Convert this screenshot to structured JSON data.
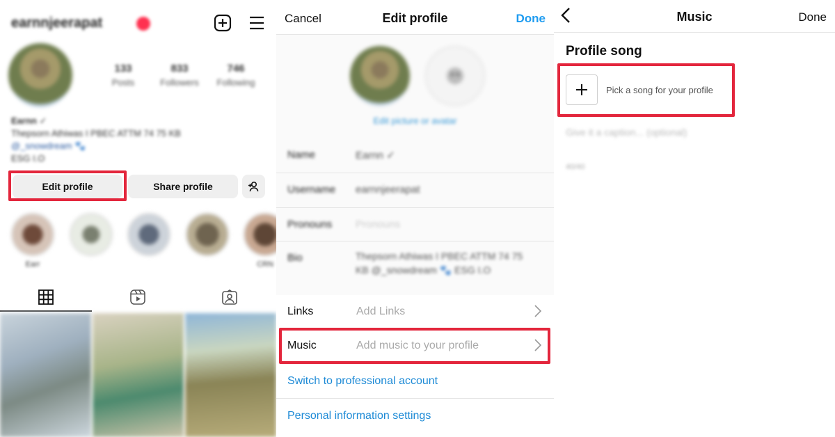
{
  "profile": {
    "username": "earnnjeerapat",
    "stats": [
      {
        "number": "133",
        "label": "Posts"
      },
      {
        "number": "833",
        "label": "Followers"
      },
      {
        "number": "746",
        "label": "Following"
      }
    ],
    "bio_name": "Earnn ✓",
    "bio_line1": "Thepsorn Athiwas I PBEC ATTM 74 75 KB",
    "bio_line2": "@_snowdream 🐾",
    "bio_line3": "ESG I.O",
    "edit_button": "Edit profile",
    "share_button": "Share profile",
    "highlights": [
      "Earr",
      "",
      "",
      "",
      "CRN"
    ]
  },
  "edit": {
    "cancel": "Cancel",
    "title": "Edit profile",
    "done": "Done",
    "edit_picture_link": "Edit picture or avatar",
    "fields": [
      {
        "label": "Name",
        "value": "Earnn ✓"
      },
      {
        "label": "Username",
        "value": "earnnjeerapat"
      },
      {
        "label": "Pronouns",
        "value": "Pronouns"
      },
      {
        "label": "Bio",
        "value": "Thepsorn Athiwas I PBEC ATTM 74 75 KB @_snowdream 🐾 ESG I.O"
      }
    ],
    "links_label": "Links",
    "links_placeholder": "Add Links",
    "music_label": "Music",
    "music_placeholder": "Add music to your profile",
    "switch_pro": "Switch to professional account",
    "personal_info": "Personal information settings"
  },
  "music": {
    "title": "Music",
    "done": "Done",
    "section": "Profile song",
    "pick": "Pick a song for your profile",
    "caption_placeholder": "Give it a caption... (optional)",
    "counter": "40/40"
  },
  "colors": {
    "highlight_red": "#e3263c",
    "link_blue": "#1d8ad6",
    "done_blue": "#1d9bf0"
  }
}
